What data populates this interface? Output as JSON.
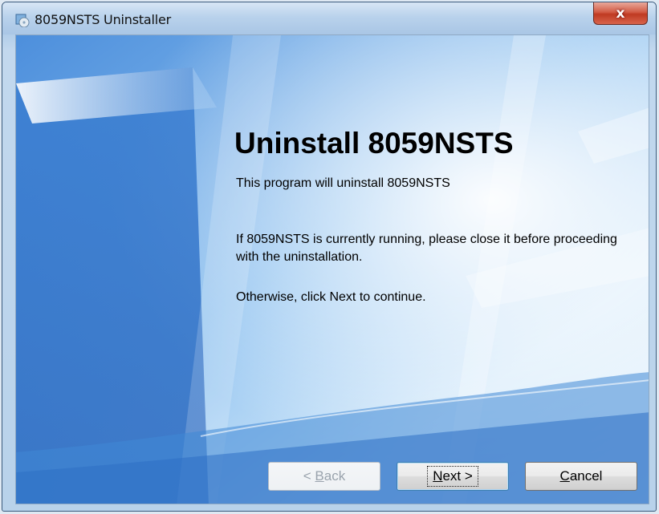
{
  "window": {
    "title": "8059NSTS Uninstaller",
    "close_glyph": "x"
  },
  "content": {
    "heading": "Uninstall 8059NSTS",
    "intro": "This program will uninstall 8059NSTS",
    "warning": "If 8059NSTS is currently running, please close it before proceeding with the uninstallation.",
    "instruction": "Otherwise, click Next to continue."
  },
  "buttons": {
    "back": {
      "prefix": "< ",
      "mnemonic": "B",
      "rest": "ack",
      "enabled": false
    },
    "next": {
      "mnemonic": "N",
      "rest": "ext >",
      "default": true
    },
    "cancel": {
      "mnemonic": "C",
      "rest": "ancel"
    }
  },
  "icons": {
    "app": "installer-disc-icon",
    "close": "close-icon"
  },
  "colors": {
    "background_blue": "#5e9be0",
    "close_red": "#c9452d",
    "disabled_text": "#9aa3ad"
  }
}
